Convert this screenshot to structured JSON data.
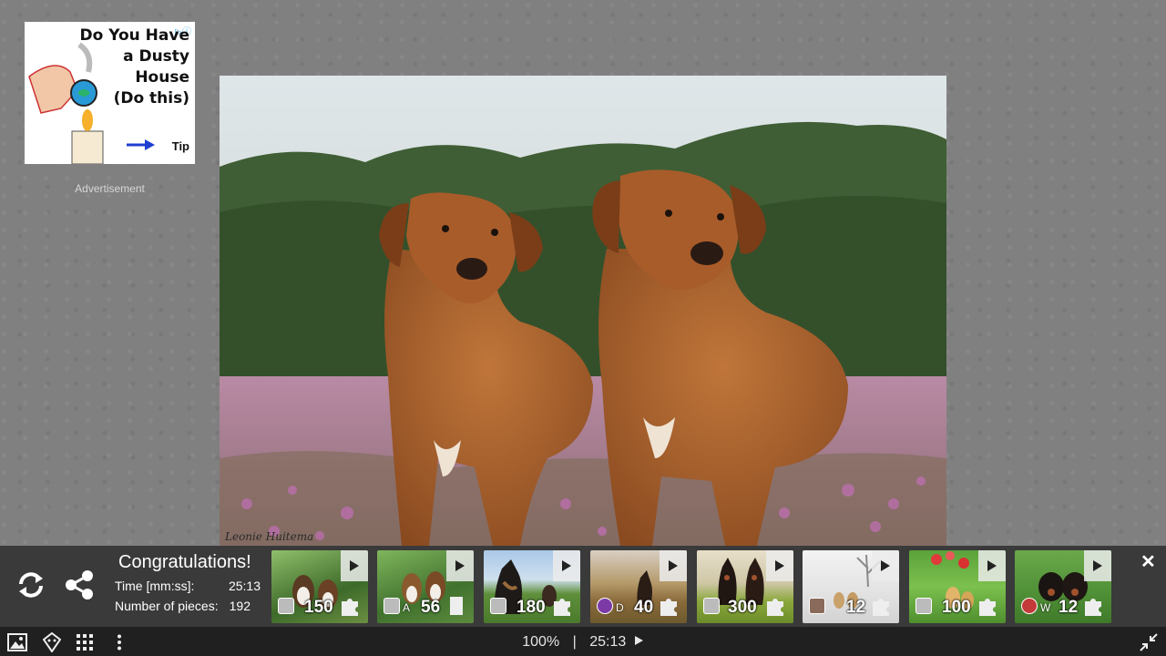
{
  "advertisement": {
    "headline_lines": [
      "Do You Have",
      "a Dusty",
      "House",
      "(Do this)"
    ],
    "cta": "Tip",
    "label": "Advertisement"
  },
  "puzzle": {
    "signature": "Leonie Huitema"
  },
  "congrats": {
    "title": "Congratulations!",
    "time_label": "Time [mm:ss]:",
    "time_value": "25:13",
    "pieces_label": "Number of pieces:",
    "pieces_value": "192"
  },
  "suggestions": [
    {
      "count": "150",
      "letter": "",
      "piece": "puzzle"
    },
    {
      "count": "56",
      "letter": "A",
      "piece": "rect"
    },
    {
      "count": "180",
      "letter": "",
      "piece": "puzzle"
    },
    {
      "count": "40",
      "letter": "D",
      "piece": "puzzle"
    },
    {
      "count": "300",
      "letter": "",
      "piece": "puzzle"
    },
    {
      "count": "12",
      "letter": "",
      "piece": "puzzle"
    },
    {
      "count": "100",
      "letter": "",
      "piece": "puzzle"
    },
    {
      "count": "12",
      "letter": "W",
      "piece": "puzzle"
    }
  ],
  "toolbar": {
    "zoom": "100%",
    "separator": "|",
    "time": "25:13"
  },
  "icons": {
    "ad": [
      "info-icon",
      "arrow-right-icon"
    ],
    "panel": [
      "restart-icon",
      "share-icon",
      "play-icon",
      "puzzle-piece-icon",
      "close-icon"
    ],
    "toolbar": [
      "image-icon",
      "ghost-icon",
      "grid-icon",
      "more-icon",
      "play-icon",
      "exit-fullscreen-icon"
    ]
  },
  "colors": {
    "panel_bg": "#3a3a3a",
    "toolbar_bg": "#202020",
    "page_bg": "#808080"
  }
}
